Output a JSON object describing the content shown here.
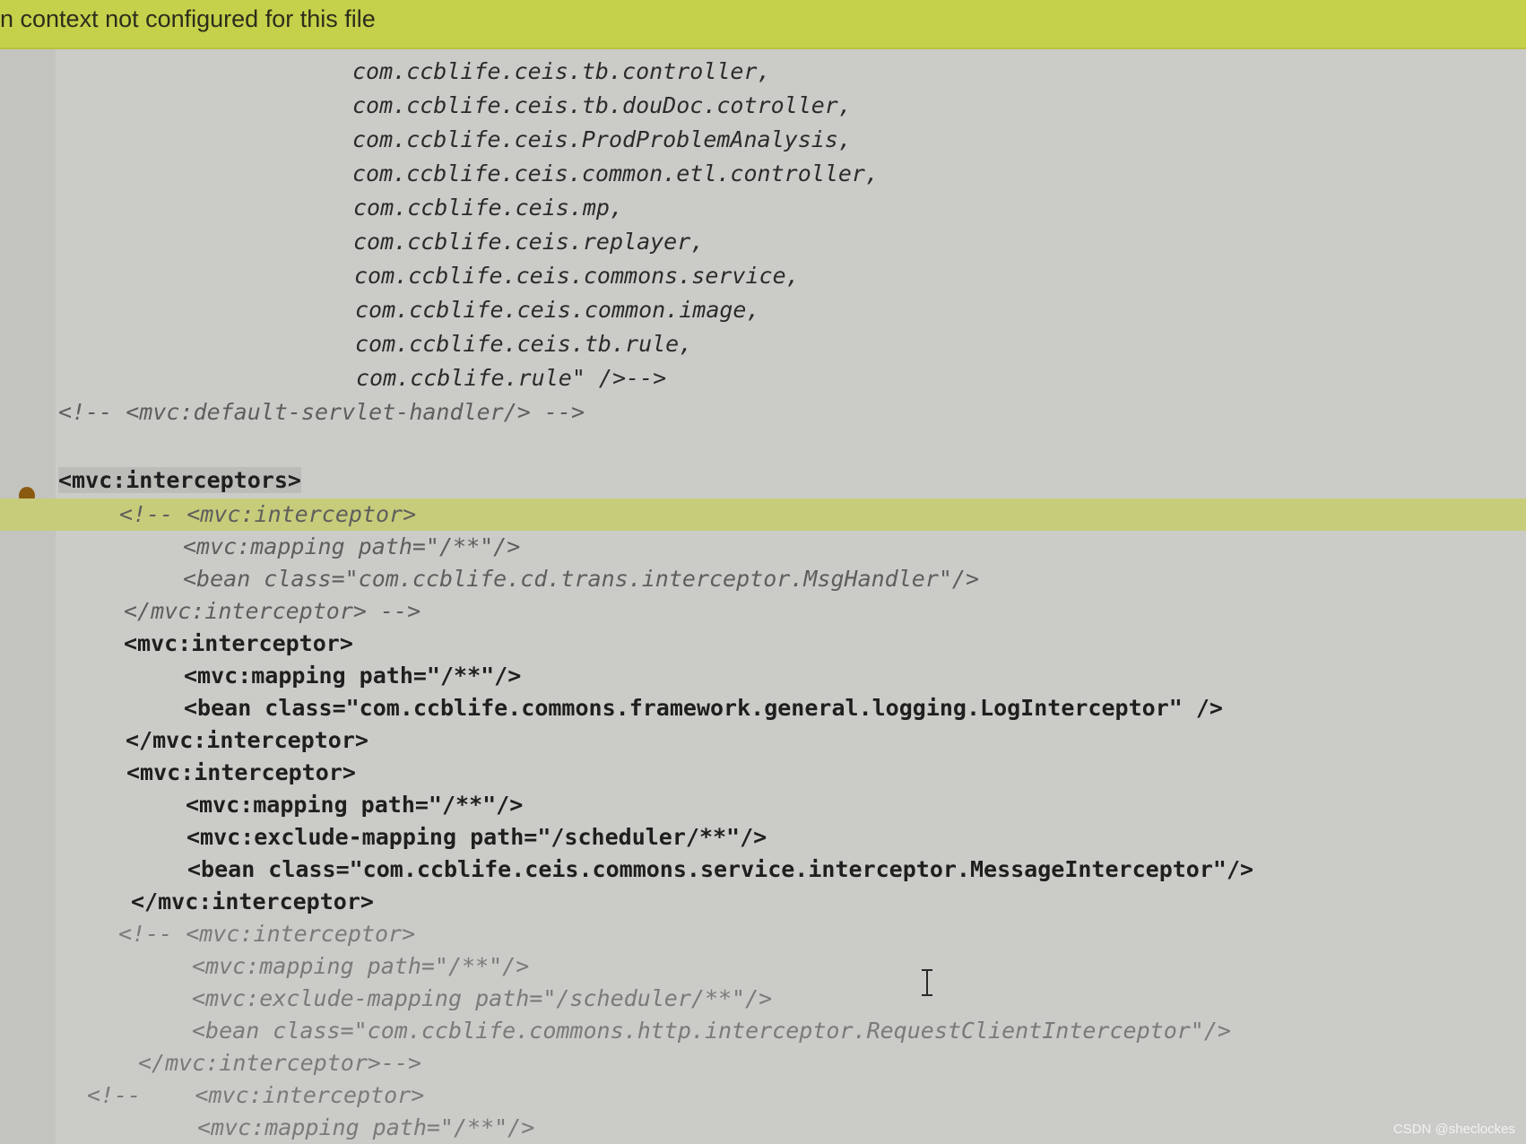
{
  "banner": {
    "text": "n context not configured for this file"
  },
  "code": {
    "lines": [
      "com.ccblife.ceis.tb.controller,",
      "com.ccblife.ceis.tb.douDoc.cotroller,",
      "com.ccblife.ceis.ProdProblemAnalysis,",
      "com.ccblife.ceis.common.etl.controller,",
      "com.ccblife.ceis.mp,",
      "com.ccblife.ceis.replayer,",
      "com.ccblife.ceis.commons.service,",
      "com.ccblife.ceis.common.image,",
      "com.ccblife.ceis.tb.rule,",
      "com.ccblife.rule\" />-->",
      "<!-- <mvc:default-servlet-handler/> -->",
      "",
      "<mvc:interceptors>",
      "<!-- <mvc:interceptor>",
      "<mvc:mapping path=\"/**\"/>",
      "<bean class=\"com.ccblife.cd.trans.interceptor.MsgHandler\"/>",
      "</mvc:interceptor> -->",
      "<mvc:interceptor>",
      "<mvc:mapping path=\"/**\"/>",
      "<bean class=\"com.ccblife.commons.framework.general.logging.LogInterceptor\" />",
      "</mvc:interceptor>",
      "<mvc:interceptor>",
      "<mvc:mapping path=\"/**\"/>",
      "<mvc:exclude-mapping path=\"/scheduler/**\"/>",
      "<bean class=\"com.ccblife.ceis.commons.service.interceptor.MessageInterceptor\"/>",
      "</mvc:interceptor>",
      "<!-- <mvc:interceptor>",
      "<mvc:mapping path=\"/**\"/>",
      "<mvc:exclude-mapping path=\"/scheduler/**\"/>",
      "<bean class=\"com.ccblife.commons.http.interceptor.RequestClientInterceptor\"/>",
      "</mvc:interceptor>-->",
      "<!--    <mvc:interceptor>",
      "<mvc:mapping path=\"/**\"/>"
    ]
  },
  "icons": {
    "gutter_bulb": "lightbulb-icon",
    "text_cursor": "ibeam-cursor-icon"
  },
  "watermark": "CSDN @sheclockes",
  "colors": {
    "banner": "#c5d14a",
    "editor_bg": "#cbccc8",
    "highlight_line": "#c7cc7a",
    "attr_name": "#1a3fa3",
    "attr_value": "#1f6a2a"
  }
}
